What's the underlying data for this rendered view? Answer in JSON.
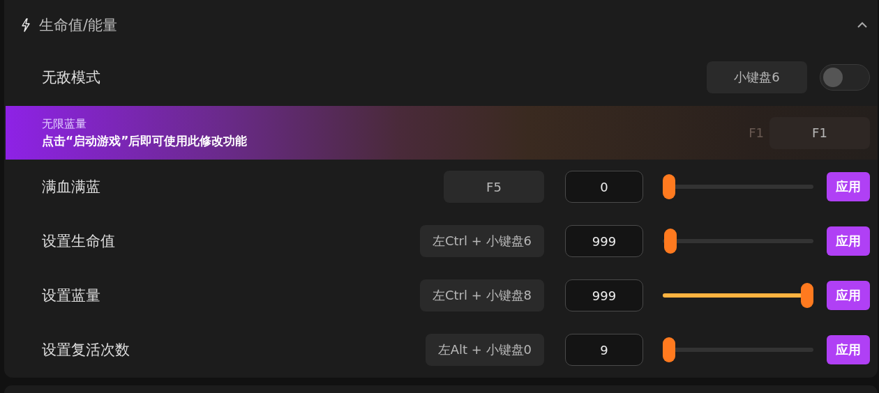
{
  "section": {
    "title": "生命值/能量",
    "expanded": true
  },
  "rows": [
    {
      "kind": "toggle",
      "label": "无敌模式",
      "hotkey": "小键盘6",
      "on": false
    },
    {
      "kind": "locked",
      "label": "无限蓝量",
      "notice": "点击“启动游戏”后即可使用此修改功能",
      "ghost_hotkey": "F1",
      "hotkey": "F1"
    },
    {
      "kind": "slider",
      "label": "满血满蓝",
      "hotkey": "F5",
      "value": "0",
      "level": 0,
      "button": "应用"
    },
    {
      "kind": "slider",
      "label": "设置生命值",
      "hotkey": "左Ctrl + 小键盘6",
      "value": "999",
      "level": 0.01,
      "button": "应用"
    },
    {
      "kind": "slider",
      "label": "设置蓝量",
      "hotkey": "左Ctrl + 小键盘8",
      "value": "999",
      "level": 1,
      "button": "应用"
    },
    {
      "kind": "slider",
      "label": "设置复活次数",
      "hotkey": "左Alt + 小键盘0",
      "value": "9",
      "level": 0,
      "button": "应用"
    }
  ]
}
